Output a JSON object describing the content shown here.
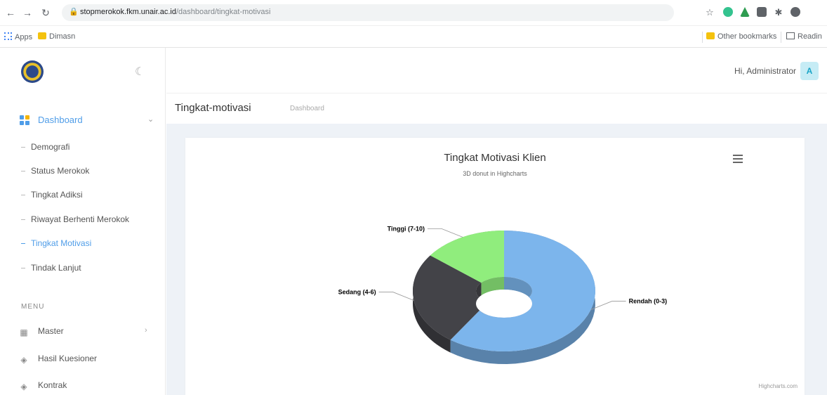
{
  "browser": {
    "url_host": "stopmerokok.fkm.unair.ac.id",
    "url_path": "/dashboard/tingkat-motivasi",
    "bookmarks": {
      "apps": "Apps",
      "folder1": "Dimasn",
      "other": "Other bookmarks",
      "reading": "Readin"
    }
  },
  "sidebar": {
    "dashboard_label": "Dashboard",
    "sub_items": [
      {
        "label": "Demografi"
      },
      {
        "label": "Status Merokok"
      },
      {
        "label": "Tingkat Adiksi"
      },
      {
        "label": "Riwayat Berhenti Merokok"
      },
      {
        "label": "Tingkat Motivasi"
      },
      {
        "label": "Tindak Lanjut"
      }
    ],
    "section_title": "MENU",
    "menu_items": [
      {
        "label": "Master"
      },
      {
        "label": "Hasil Kuesioner"
      },
      {
        "label": "Kontrak"
      }
    ]
  },
  "topbar": {
    "greeting": "Hi, Administrator",
    "avatar_letter": "A"
  },
  "page": {
    "title": "Tingkat-motivasi",
    "breadcrumb": "Dashboard"
  },
  "chart_data": {
    "type": "pie",
    "title": "Tingkat Motivasi Klien",
    "subtitle": "3D donut in Highcharts",
    "slices": [
      {
        "name": "Rendah (0-3)",
        "value": 60,
        "color": "#7cb5ec"
      },
      {
        "name": "Sedang (4-6)",
        "value": 25,
        "color": "#434348"
      },
      {
        "name": "Tinggi (7-10)",
        "value": 15,
        "color": "#90ed7d"
      }
    ],
    "credits": "Highcharts.com"
  },
  "colors": {
    "accent": "#4f9de8",
    "content_bg": "#eef2f7"
  }
}
